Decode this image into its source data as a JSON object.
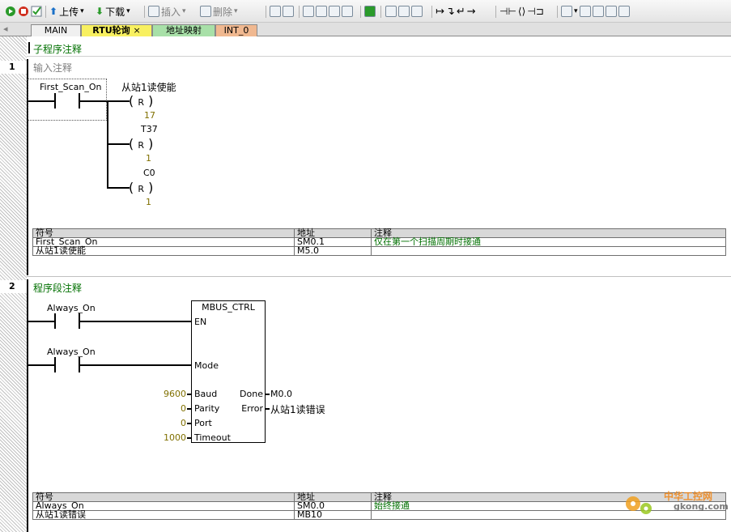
{
  "toolbar": {
    "upload": "上传",
    "download": "下载",
    "insert": "插入",
    "delete": "删除"
  },
  "tabs": [
    {
      "label": "MAIN"
    },
    {
      "label": "RTU轮询",
      "close": "×"
    },
    {
      "label": "地址映射"
    },
    {
      "label": "INT_0"
    }
  ],
  "program": {
    "header": "子程序注释",
    "networks": [
      {
        "number": "1",
        "comment": "输入注释",
        "contact": "First_Scan_On",
        "coils": [
          {
            "label": "从站1读使能",
            "type": "R",
            "count": "17"
          },
          {
            "label": "T37",
            "type": "R",
            "count": "1"
          },
          {
            "label": "C0",
            "type": "R",
            "count": "1"
          }
        ],
        "symbol_table": {
          "headers": [
            "符号",
            "地址",
            "注释"
          ],
          "rows": [
            [
              "First_Scan_On",
              "SM0.1",
              "仅在第一个扫描周期时接通"
            ],
            [
              "从站1读使能",
              "M5.0",
              ""
            ]
          ]
        }
      },
      {
        "number": "2",
        "comment": "程序段注释",
        "contact1": "Always_On",
        "contact2": "Always_On",
        "block": {
          "title": "MBUS_CTRL",
          "en": "EN",
          "mode": "Mode",
          "baud": "Baud",
          "parity": "Parity",
          "port": "Port",
          "timeout": "Timeout",
          "done": "Done",
          "error": "Error",
          "baud_val": "9600",
          "parity_val": "0",
          "port_val": "0",
          "timeout_val": "1000",
          "done_out": "M0.0",
          "error_out": "从站1读错误"
        },
        "symbol_table": {
          "headers": [
            "符号",
            "地址",
            "注释"
          ],
          "rows": [
            [
              "Always_On",
              "SM0.0",
              "始终接通"
            ],
            [
              "从站1读错误",
              "MB10",
              ""
            ]
          ]
        }
      }
    ]
  },
  "watermark": {
    "cn": "中华工控网",
    "url": "gkong.com"
  }
}
